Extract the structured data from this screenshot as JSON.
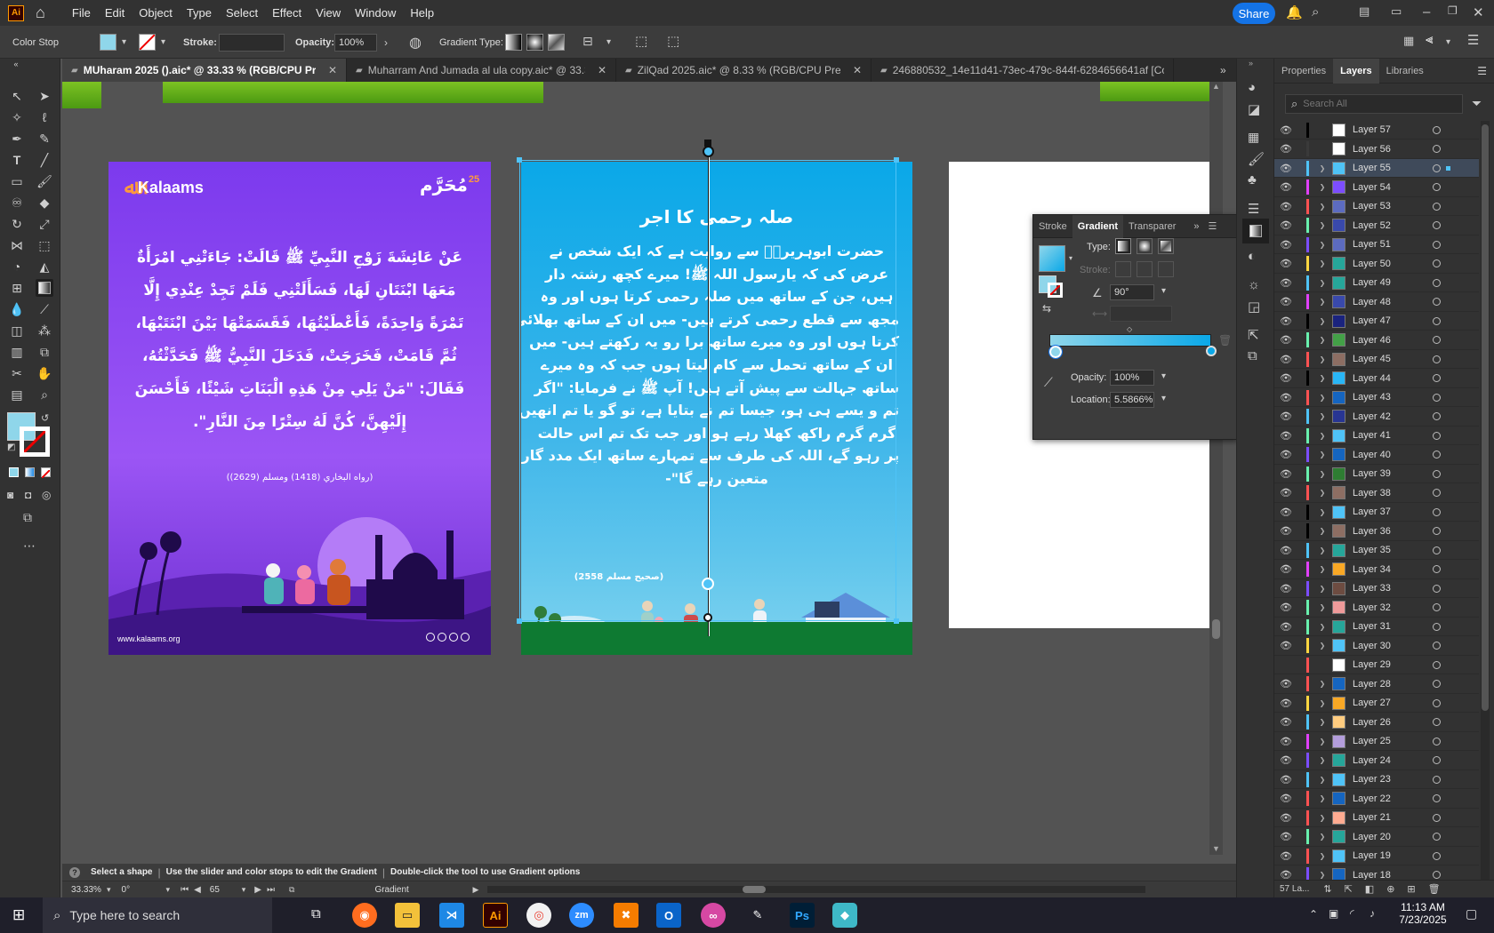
{
  "menu": [
    "File",
    "Edit",
    "Object",
    "Type",
    "Select",
    "Effect",
    "View",
    "Window",
    "Help"
  ],
  "app_logo": "Ai",
  "share_label": "Share",
  "control": {
    "mode": "Color Stop",
    "stroke_label": "Stroke:",
    "opacity_label": "Opacity:",
    "opacity_value": "100%",
    "gradient_type_label": "Gradient Type:"
  },
  "tabs": [
    {
      "label": "MUharam 2025 ().aic* @ 33.33 % (RGB/CPU Preview)",
      "active": true
    },
    {
      "label": "Muharram And Jumada al ula copy.aic* @ 33.33 ...",
      "active": false
    },
    {
      "label": "ZilQad 2025.aic* @ 8.33 % (RGB/CPU Previe...",
      "active": false
    },
    {
      "label": "246880532_14e11d41-73ec-479c-844f-6284656641af [Converte",
      "active": false
    }
  ],
  "artboard1": {
    "brand": "Kalaams",
    "badge": "مُحَرَّم",
    "badge_num": "25",
    "arabic_lines": [
      "عَنْ عَائِشَةَ زَوْجِ النَّبِيِّ ﷺ قَالَتْ: جَاءَتْنِي امْرَأَةٌ",
      "مَعَهَا ابْنَتَانِ لَهَا، فَسَأَلَتْنِي فَلَمْ تَجِدْ عِنْدِي إِلَّا",
      "تَمْرَةً وَاحِدَةً، فَأَعْطَيْتُهَا، فَقَسَمَتْهَا بَيْنَ ابْنَتَيْهَا،",
      "ثُمَّ قَامَتْ، فَخَرَجَتْ، فَدَخَلَ النَّبِيُّ ﷺ فَحَدَّثْتُهُ،",
      "فَقَالَ: \"مَنْ يَلِي مِنْ هَذِهِ الْبَنَاتِ شَيْئًا، فَأَحْسَنَ",
      "إِلَيْهِنَّ، كُنَّ لَهُ سِتْرًا مِنَ النَّارِ\"."
    ],
    "reference": "(رواه البخاري (1418) ومسلم (2629))",
    "website": "www.kalaams.org"
  },
  "artboard2": {
    "title": "صلہ رحمی کا اجر",
    "urdu_lines": [
      "حضرت ابوہریرہؓ سے روایت ہے کہ ایک شخص نے",
      "عرض کی کہ یارسول اللہ ﷺ! میرے کچھ رشتہ دار",
      "ہیں، جن کے ساتھ میں صلہ رحمی کرتا ہوں اور وہ",
      "مجھ سے قطع رحمی کرتے ہیں- میں ان کے ساتھ بھلائی",
      "کرتا ہوں اور وہ میرے ساتھ برا رو یہ رکھتے ہیں- میں",
      "ان کے ساتھ تحمل سے کام لیتا ہوں جب کہ وہ میرے",
      "ساتھ جہالت سے پیش آتے ہیں! آپ ﷺ نے فرمایا: \"اگر",
      "تم و یسے ہی ہو، جیسا تم نے بتایا ہے، تو گو یا تم انھیں",
      "گرم گرم راکھ کھلا رہے ہو اور جب تک تم اس حالت",
      "پر رہو گے، اللہ کی طرف سے تمہارے ساتھ ایک مدد گار",
      "متعین رہے گا\"-"
    ],
    "reference": "(صحیح مسلم 2558)"
  },
  "gradient_panel": {
    "tabs": [
      "Stroke",
      "Gradient",
      "Transparer"
    ],
    "type_label": "Type:",
    "stroke_label": "Stroke:",
    "angle": "90°",
    "opacity_label": "Opacity:",
    "opacity_value": "100%",
    "location_label": "Location:",
    "location_value": "5.5866%"
  },
  "layers_panel": {
    "tabs": [
      "Properties",
      "Layers",
      "Libraries"
    ],
    "search_placeholder": "Search All",
    "footer_count": "57 La...",
    "layers": [
      {
        "name": "Layer 57",
        "color": "#000000",
        "thumb": "#ffffff",
        "visible": true,
        "expand": false
      },
      {
        "name": "Layer 56",
        "color": "#3a3a3a",
        "thumb": "#ffffff",
        "visible": true,
        "expand": false
      },
      {
        "name": "Layer 55",
        "color": "#4fc3f7",
        "thumb": "#4fc3f7",
        "visible": true,
        "expand": true,
        "selected": true
      },
      {
        "name": "Layer 54",
        "color": "#e040fb",
        "thumb": "#7c4dff",
        "visible": true,
        "expand": true
      },
      {
        "name": "Layer 53",
        "color": "#ff5252",
        "thumb": "#5c6bc0",
        "visible": true,
        "expand": true
      },
      {
        "name": "Layer 52",
        "color": "#69f0ae",
        "thumb": "#3949ab",
        "visible": true,
        "expand": true
      },
      {
        "name": "Layer 51",
        "color": "#7c4dff",
        "thumb": "#5c6bc0",
        "visible": true,
        "expand": true
      },
      {
        "name": "Layer 50",
        "color": "#ffd740",
        "thumb": "#26a69a",
        "visible": true,
        "expand": true
      },
      {
        "name": "Layer 49",
        "color": "#4fc3f7",
        "thumb": "#26a69a",
        "visible": true,
        "expand": true
      },
      {
        "name": "Layer 48",
        "color": "#e040fb",
        "thumb": "#3949ab",
        "visible": true,
        "expand": true
      },
      {
        "name": "Layer 47",
        "color": "#000000",
        "thumb": "#1a237e",
        "visible": true,
        "expand": true
      },
      {
        "name": "Layer 46",
        "color": "#69f0ae",
        "thumb": "#43a047",
        "visible": true,
        "expand": true
      },
      {
        "name": "Layer 45",
        "color": "#ff5252",
        "thumb": "#8d6e63",
        "visible": true,
        "expand": true
      },
      {
        "name": "Layer 44",
        "color": "#000000",
        "thumb": "#29b6f6",
        "visible": true,
        "expand": true
      },
      {
        "name": "Layer 43",
        "color": "#ff5252",
        "thumb": "#1565c0",
        "visible": true,
        "expand": true
      },
      {
        "name": "Layer 42",
        "color": "#4fc3f7",
        "thumb": "#283593",
        "visible": true,
        "expand": true
      },
      {
        "name": "Layer 41",
        "color": "#69f0ae",
        "thumb": "#4fc3f7",
        "visible": true,
        "expand": true
      },
      {
        "name": "Layer 40",
        "color": "#7c4dff",
        "thumb": "#1565c0",
        "visible": true,
        "expand": true
      },
      {
        "name": "Layer 39",
        "color": "#69f0ae",
        "thumb": "#2e7d32",
        "visible": true,
        "expand": true
      },
      {
        "name": "Layer 38",
        "color": "#ff5252",
        "thumb": "#8d6e63",
        "visible": true,
        "expand": true
      },
      {
        "name": "Layer 37",
        "color": "#000000",
        "thumb": "#4fc3f7",
        "visible": true,
        "expand": true
      },
      {
        "name": "Layer 36",
        "color": "#000000",
        "thumb": "#8d6e63",
        "visible": true,
        "expand": true
      },
      {
        "name": "Layer 35",
        "color": "#4fc3f7",
        "thumb": "#26a69a",
        "visible": true,
        "expand": true
      },
      {
        "name": "Layer 34",
        "color": "#e040fb",
        "thumb": "#f9a825",
        "visible": true,
        "expand": true
      },
      {
        "name": "Layer 33",
        "color": "#7c4dff",
        "thumb": "#6d4c41",
        "visible": true,
        "expand": true
      },
      {
        "name": "Layer 32",
        "color": "#69f0ae",
        "thumb": "#ef9a9a",
        "visible": true,
        "expand": true
      },
      {
        "name": "Layer 31",
        "color": "#69f0ae",
        "thumb": "#26a69a",
        "visible": true,
        "expand": true
      },
      {
        "name": "Layer 30",
        "color": "#ffd740",
        "thumb": "#4fc3f7",
        "visible": true,
        "expand": true
      },
      {
        "name": "Layer 29",
        "color": "#ff5252",
        "thumb": "#ffffff",
        "visible": false,
        "expand": false
      },
      {
        "name": "Layer 28",
        "color": "#ff5252",
        "thumb": "#1565c0",
        "visible": true,
        "expand": true
      },
      {
        "name": "Layer 27",
        "color": "#ffd740",
        "thumb": "#f9a825",
        "visible": true,
        "expand": true
      },
      {
        "name": "Layer 26",
        "color": "#4fc3f7",
        "thumb": "#ffcc80",
        "visible": true,
        "expand": true
      },
      {
        "name": "Layer 25",
        "color": "#e040fb",
        "thumb": "#b39ddb",
        "visible": true,
        "expand": true
      },
      {
        "name": "Layer 24",
        "color": "#7c4dff",
        "thumb": "#26a69a",
        "visible": true,
        "expand": true
      },
      {
        "name": "Layer 23",
        "color": "#4fc3f7",
        "thumb": "#4fc3f7",
        "visible": true,
        "expand": true
      },
      {
        "name": "Layer 22",
        "color": "#ff5252",
        "thumb": "#1565c0",
        "visible": true,
        "expand": true
      },
      {
        "name": "Layer 21",
        "color": "#ff5252",
        "thumb": "#ffab91",
        "visible": true,
        "expand": true
      },
      {
        "name": "Layer 20",
        "color": "#69f0ae",
        "thumb": "#26a69a",
        "visible": true,
        "expand": true
      },
      {
        "name": "Layer 19",
        "color": "#ff5252",
        "thumb": "#4fc3f7",
        "visible": true,
        "expand": true
      },
      {
        "name": "Layer 18",
        "color": "#7c4dff",
        "thumb": "#1565c0",
        "visible": true,
        "expand": true
      }
    ]
  },
  "status": {
    "hint_parts": [
      "Select a shape",
      "Use the slider and color stops to edit the Gradient",
      "Double-click the tool to use Gradient options"
    ],
    "zoom": "33.33%",
    "rotate": "0°",
    "artboard_num": "65",
    "tool": "Gradient"
  },
  "taskbar": {
    "search_placeholder": "Type here to search",
    "time": "11:13 AM",
    "date": "7/23/2025"
  }
}
